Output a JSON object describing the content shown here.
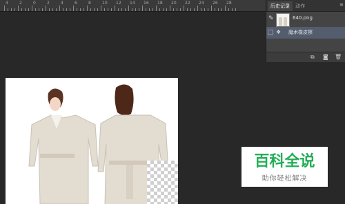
{
  "ruler": {
    "labels": [
      "4",
      "2",
      "0",
      "2",
      "4",
      "6",
      "8",
      "10",
      "12",
      "14",
      "16",
      "18",
      "20",
      "22",
      "24",
      "26",
      "28"
    ]
  },
  "history_panel": {
    "tabs": [
      {
        "label": "历史记录",
        "active": true
      },
      {
        "label": "动作",
        "active": false
      }
    ],
    "menu_icon": "panel-menu-icon",
    "snapshot_label": "640.png",
    "step_label": "魔术橡皮擦",
    "bottom_icons": [
      "new-document-from-state-icon",
      "camera-icon",
      "trash-icon"
    ]
  },
  "watermark": {
    "title": "百科全说",
    "subtitle": "助你轻松解决",
    "title_color": "#25ad57"
  }
}
